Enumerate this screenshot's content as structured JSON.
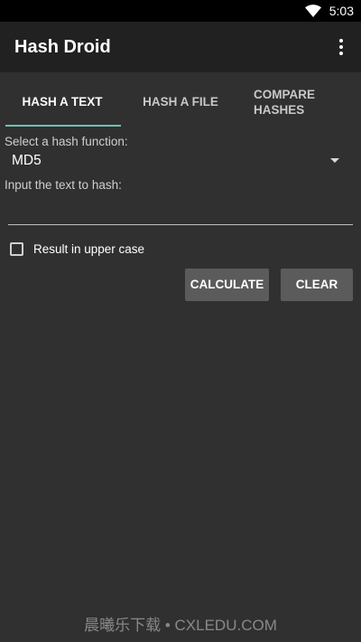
{
  "status_bar": {
    "time": "5:03",
    "wifi_icon": "wifi-icon"
  },
  "app_bar": {
    "title": "Hash Droid",
    "menu_icon": "more-vert-icon"
  },
  "tabs": [
    {
      "label": "HASH A TEXT",
      "active": true
    },
    {
      "label": "HASH A FILE",
      "active": false
    },
    {
      "label": "COMPARE HASHES",
      "line1": "COMPARE",
      "line2": "HASHES",
      "active": false
    }
  ],
  "form": {
    "hash_function_label": "Select a hash function:",
    "hash_function_value": "MD5",
    "input_label": "Input the text to hash:",
    "input_value": "",
    "uppercase_label": "Result in upper case",
    "uppercase_checked": false,
    "calculate_label": "CALCULATE",
    "clear_label": "CLEAR"
  },
  "watermark": "晨曦乐下载 • CXLEDU.COM",
  "colors": {
    "background": "#303030",
    "app_bar": "#212121",
    "status_bar": "#000000",
    "tab_indicator": "#6fc1b2",
    "button": "#5b5b5b"
  }
}
